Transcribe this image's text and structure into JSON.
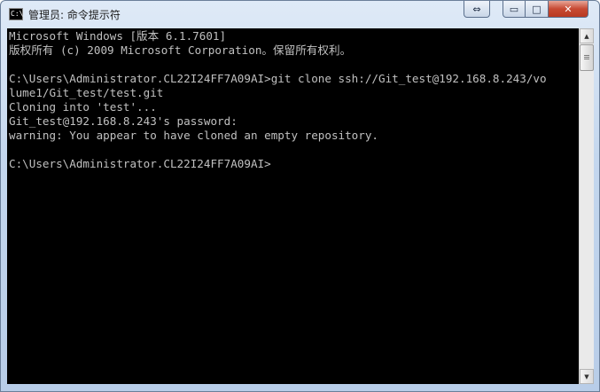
{
  "window": {
    "title": "管理员: 命令提示符",
    "icon_text": "C:\\"
  },
  "controls": {
    "extra": "⇔",
    "minimize": "▭",
    "maximize": "□",
    "close": "✕"
  },
  "scrollbar": {
    "up": "▲",
    "down": "▼"
  },
  "console": {
    "text": "Microsoft Windows [版本 6.1.7601]\n版权所有 (c) 2009 Microsoft Corporation。保留所有权利。\n\nC:\\Users\\Administrator.CL22I24FF7A09AI>git clone ssh://Git_test@192.168.8.243/vo\nlume1/Git_test/test.git\nCloning into 'test'...\nGit_test@192.168.8.243's password:\nwarning: You appear to have cloned an empty repository.\n\nC:\\Users\\Administrator.CL22I24FF7A09AI>"
  }
}
